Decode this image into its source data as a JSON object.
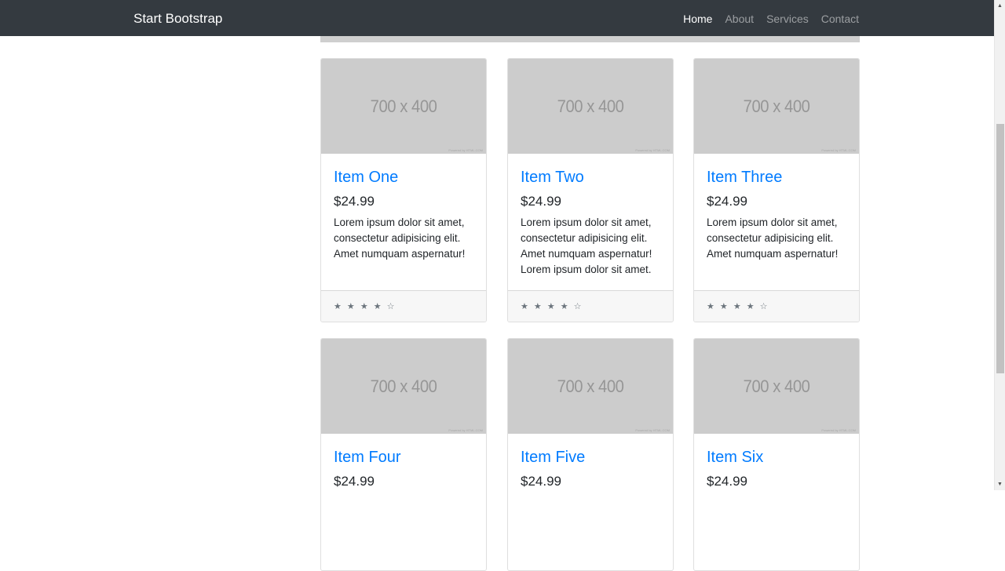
{
  "navbar": {
    "brand": "Start Bootstrap",
    "links": [
      {
        "label": "Home",
        "active": true
      },
      {
        "label": "About",
        "active": false
      },
      {
        "label": "Services",
        "active": false
      },
      {
        "label": "Contact",
        "active": false
      }
    ]
  },
  "products": [
    {
      "image_label": "700 x 400",
      "image_caption": "Powered by HTML.COM",
      "title": "Item One",
      "price": "$24.99",
      "text": "Lorem ipsum dolor sit amet, consectetur adipisicing elit. Amet numquam aspernatur!",
      "rating": "★ ★ ★ ★ ☆"
    },
    {
      "image_label": "700 x 400",
      "image_caption": "Powered by HTML.COM",
      "title": "Item Two",
      "price": "$24.99",
      "text": "Lorem ipsum dolor sit amet, consectetur adipisicing elit. Amet numquam aspernatur! Lorem ipsum dolor sit amet.",
      "rating": "★ ★ ★ ★ ☆"
    },
    {
      "image_label": "700 x 400",
      "image_caption": "Powered by HTML.COM",
      "title": "Item Three",
      "price": "$24.99",
      "text": "Lorem ipsum dolor sit amet, consectetur adipisicing elit. Amet numquam aspernatur!",
      "rating": "★ ★ ★ ★ ☆"
    },
    {
      "image_label": "700 x 400",
      "image_caption": "Powered by HTML.COM",
      "title": "Item Four",
      "price": "$24.99",
      "text": "",
      "rating": ""
    },
    {
      "image_label": "700 x 400",
      "image_caption": "Powered by HTML.COM",
      "title": "Item Five",
      "price": "$24.99",
      "text": "",
      "rating": ""
    },
    {
      "image_label": "700 x 400",
      "image_caption": "Powered by HTML.COM",
      "title": "Item Six",
      "price": "$24.99",
      "text": "",
      "rating": ""
    }
  ],
  "colors": {
    "navbar_bg": "#343a40",
    "link": "#007bff",
    "placeholder_bg": "#cccccc"
  },
  "icons": {
    "scroll_up": "scroll-up-arrow-icon",
    "scroll_down": "scroll-down-arrow-icon",
    "star": "star-icon"
  }
}
